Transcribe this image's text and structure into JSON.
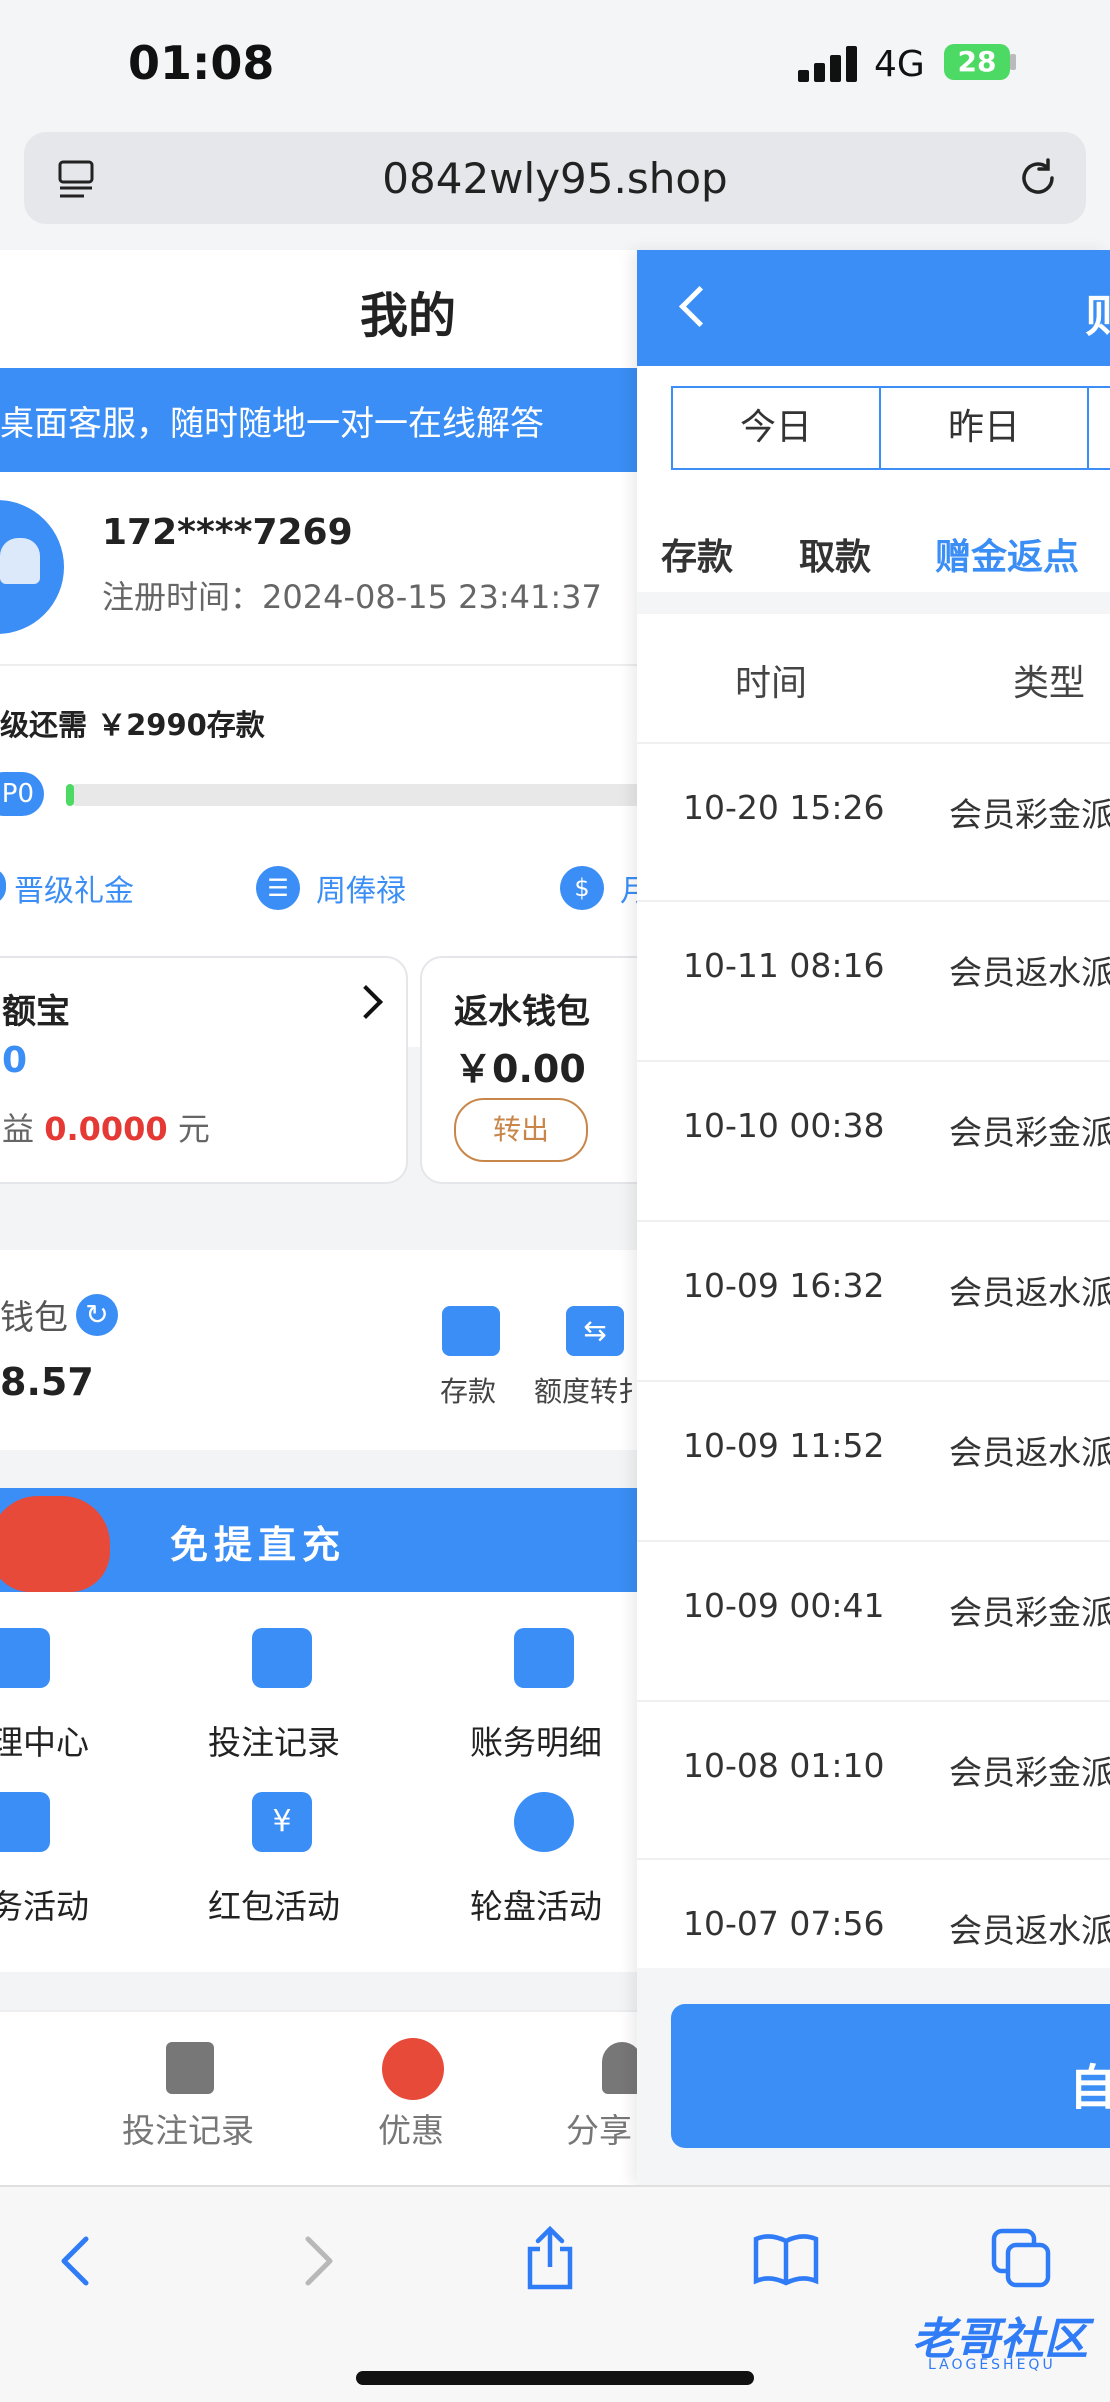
{
  "status_bar": {
    "time": "01:08",
    "network": "4G",
    "battery": "28"
  },
  "address_bar": {
    "url": "0842wly95.shop"
  },
  "left_panel": {
    "title": "我的",
    "banner": "桌面客服，随时随地一对一在线解答",
    "profile": {
      "phone": "172****7269",
      "register_label": "注册时间：2024-08-15 23:41:37"
    },
    "vip": {
      "upgrade_text": "级还需 ￥2990存款",
      "level_badge": "P0"
    },
    "benefits": [
      "晋级礼金",
      "周俸禄",
      "月"
    ],
    "yuebao": {
      "title": "额宝",
      "amount": "0",
      "income_prefix": "益",
      "income_value": "0.0000",
      "income_unit": "元"
    },
    "rebate_wallet": {
      "title": "返水钱包",
      "amount": "￥0.00",
      "transfer_button": "转出"
    },
    "wallet": {
      "title": "钱包",
      "amount": "8.57",
      "actions": [
        "存款",
        "额度转扌"
      ]
    },
    "promo": {
      "title": "免提直充"
    },
    "grid": [
      "理中心",
      "投注记录",
      "账务明细",
      "务活动",
      "红包活动",
      "轮盘活动"
    ],
    "tabbar": [
      "",
      "投注记录",
      "优惠",
      "分享"
    ]
  },
  "right_panel": {
    "header_title": "则",
    "date_tabs": [
      "今日",
      "昨日"
    ],
    "type_tabs": [
      "存款",
      "取款",
      "赠金返点"
    ],
    "active_type_tab": 2,
    "columns": [
      "时间",
      "类型"
    ],
    "rows": [
      {
        "time": "10-20 15:26",
        "type": "会员彩金派"
      },
      {
        "time": "10-11 08:16",
        "type": "会员返水派"
      },
      {
        "time": "10-10 00:38",
        "type": "会员彩金派"
      },
      {
        "time": "10-09 16:32",
        "type": "会员返水派"
      },
      {
        "time": "10-09 11:52",
        "type": "会员返水派"
      },
      {
        "time": "10-09 00:41",
        "type": "会员彩金派"
      },
      {
        "time": "10-08 01:10",
        "type": "会员彩金派"
      },
      {
        "time": "10-07 07:56",
        "type": "会员返水派"
      }
    ],
    "footer_button": "自"
  },
  "watermark": {
    "brand": "老哥社区",
    "sub": "LAOGESHEQU"
  },
  "colors": {
    "accent": "#3b8ef5",
    "danger": "#e53935",
    "success": "#4cd964"
  }
}
